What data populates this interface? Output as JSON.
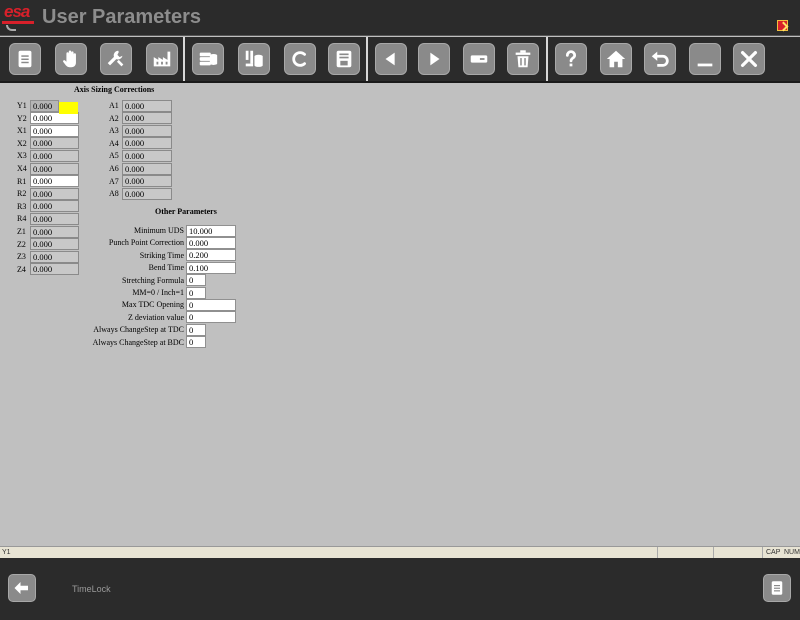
{
  "window": {
    "logo_text": "esa",
    "title": "User Parameters"
  },
  "toolbar": {
    "buttons": [
      {
        "name": "document-icon"
      },
      {
        "name": "hand-icon"
      },
      {
        "name": "wrench-icon"
      },
      {
        "name": "factory-icon"
      },
      {
        "name": "database-stack-icon"
      },
      {
        "name": "database-edit-icon"
      },
      {
        "name": "c-letter-icon"
      },
      {
        "name": "save-icon"
      },
      {
        "name": "arrow-left-icon"
      },
      {
        "name": "arrow-right-icon"
      },
      {
        "name": "minus-field-icon"
      },
      {
        "name": "trash-icon"
      },
      {
        "name": "help-icon"
      },
      {
        "name": "home-icon"
      },
      {
        "name": "undo-icon"
      },
      {
        "name": "minimize-icon"
      },
      {
        "name": "close-icon"
      }
    ]
  },
  "axis_sizing": {
    "heading": "Axis Sizing Corrections",
    "left": [
      {
        "label": "Y1",
        "value": "0.000",
        "style": "sel"
      },
      {
        "label": "Y2",
        "value": "0.000",
        "style": "white"
      },
      {
        "label": "X1",
        "value": "0.000",
        "style": "white"
      },
      {
        "label": "X2",
        "value": "0.000",
        "style": "gray"
      },
      {
        "label": "X3",
        "value": "0.000",
        "style": "gray"
      },
      {
        "label": "X4",
        "value": "0.000",
        "style": "gray"
      },
      {
        "label": "R1",
        "value": "0.000",
        "style": "white"
      },
      {
        "label": "R2",
        "value": "0.000",
        "style": "gray"
      },
      {
        "label": "R3",
        "value": "0.000",
        "style": "gray"
      },
      {
        "label": "R4",
        "value": "0.000",
        "style": "gray"
      },
      {
        "label": "Z1",
        "value": "0.000",
        "style": "gray"
      },
      {
        "label": "Z2",
        "value": "0.000",
        "style": "gray"
      },
      {
        "label": "Z3",
        "value": "0.000",
        "style": "gray"
      },
      {
        "label": "Z4",
        "value": "0.000",
        "style": "gray"
      }
    ],
    "right": [
      {
        "label": "A1",
        "value": "0.000"
      },
      {
        "label": "A2",
        "value": "0.000"
      },
      {
        "label": "A3",
        "value": "0.000"
      },
      {
        "label": "A4",
        "value": "0.000"
      },
      {
        "label": "A5",
        "value": "0.000"
      },
      {
        "label": "A6",
        "value": "0.000"
      },
      {
        "label": "A7",
        "value": "0.000"
      },
      {
        "label": "A8",
        "value": "0.000"
      }
    ]
  },
  "other_parameters": {
    "heading": "Other Parameters",
    "rows": [
      {
        "label": "Minimum UDS",
        "value": "10.000"
      },
      {
        "label": "Punch Point Correction",
        "value": "0.000"
      },
      {
        "label": "Striking Time",
        "value": "0.200"
      },
      {
        "label": "Bend Time",
        "value": "0.100"
      },
      {
        "label": "Stretching Formula",
        "value": "0"
      },
      {
        "label": "MM=0 / Inch=1",
        "value": "0"
      },
      {
        "label": "Max TDC Opening",
        "value": "0"
      },
      {
        "label": "Z deviation value",
        "value": "0"
      },
      {
        "label": "Always ChangeStep at TDC",
        "value": "0"
      },
      {
        "label": "Always ChangeStep at BDC",
        "value": "0"
      }
    ]
  },
  "statusbar": {
    "left": "Y1",
    "cap": "CAP",
    "num": "NUM"
  },
  "bottombar": {
    "timelock": "TimeLock"
  },
  "colors": {
    "bar_bg": "#2b2b2b",
    "panel_bg": "#c0c0c0",
    "button_bg": "#8a8a8a",
    "brand_red": "#d8202a",
    "selection_yellow": "#ffff00"
  }
}
